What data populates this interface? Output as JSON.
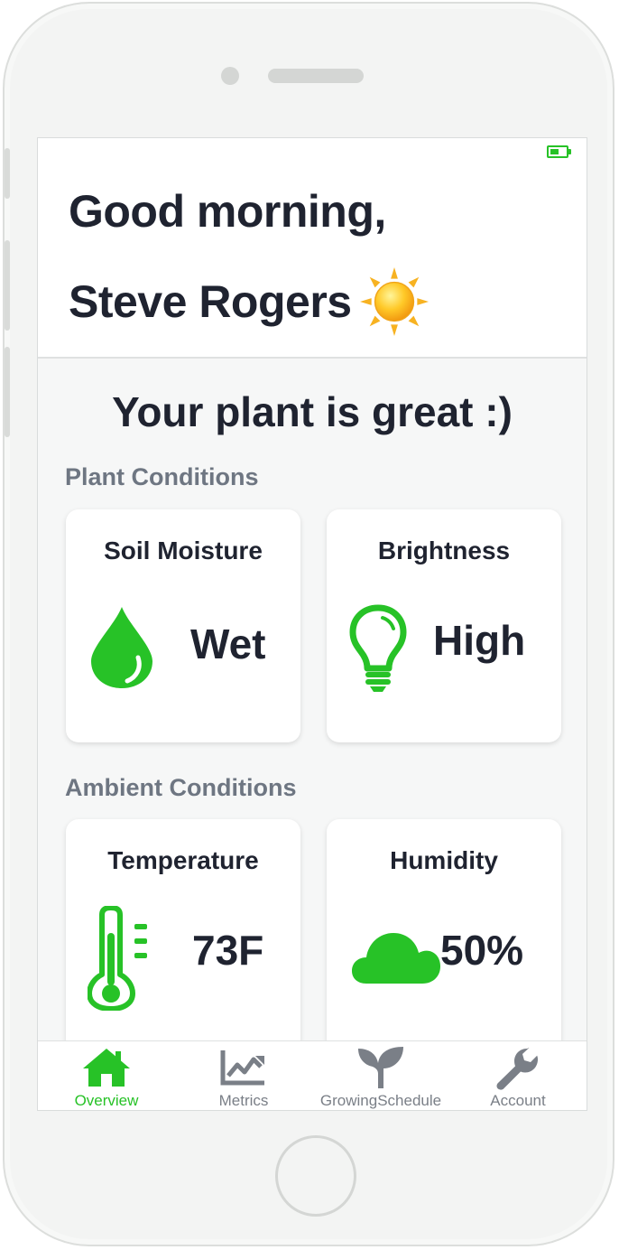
{
  "header": {
    "greeting_line1": "Good morning,",
    "greeting_line2": "Steve Rogers",
    "weather_icon": "sun-icon"
  },
  "status": {
    "message": "Your plant is great :)"
  },
  "plant_conditions": {
    "title": "Plant Conditions",
    "cards": [
      {
        "title": "Soil Moisture",
        "value": "Wet",
        "icon": "water-drop-icon"
      },
      {
        "title": "Brightness",
        "value": "High",
        "icon": "lightbulb-icon"
      }
    ]
  },
  "ambient_conditions": {
    "title": "Ambient Conditions",
    "cards": [
      {
        "title": "Temperature",
        "value": "73F",
        "icon": "thermometer-icon"
      },
      {
        "title": "Humidity",
        "value": "50%",
        "icon": "cloud-icon"
      }
    ]
  },
  "tabbar": {
    "tabs": [
      {
        "label": "Overview",
        "icon": "home-icon",
        "active": true
      },
      {
        "label": "Metrics",
        "icon": "chart-icon",
        "active": false
      },
      {
        "label": "GrowingSchedule",
        "icon": "sprout-icon",
        "active": false
      },
      {
        "label": "Account",
        "icon": "wrench-icon",
        "active": false
      }
    ]
  },
  "colors": {
    "accent": "#27c227",
    "text_dark": "#1f2330",
    "text_muted": "#6e7682",
    "tab_inactive": "#7a7f87"
  }
}
